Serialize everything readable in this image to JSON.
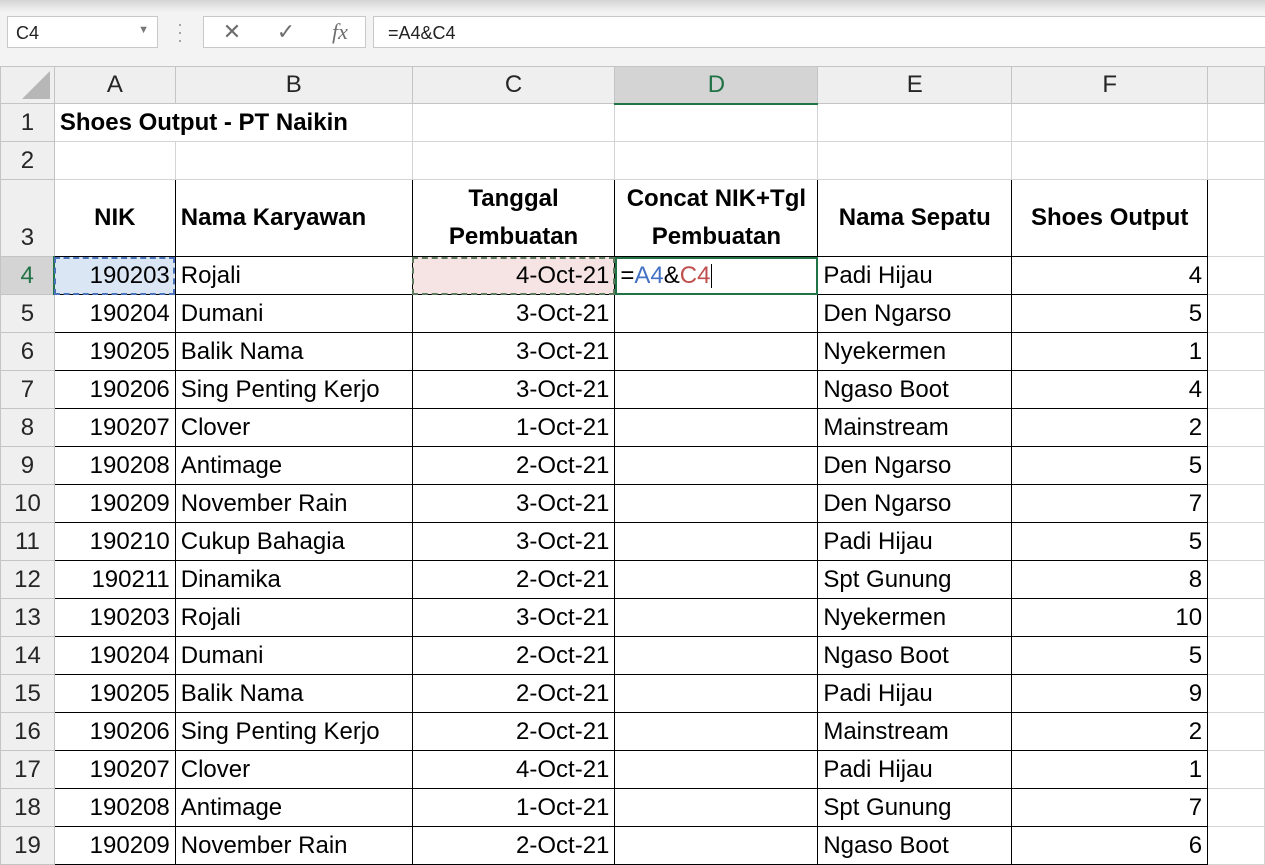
{
  "name_box": {
    "value": "C4"
  },
  "formula_bar": {
    "cancel_glyph": "✕",
    "enter_glyph": "✓",
    "fx_glyph": "fx",
    "formula": "=A4&C4"
  },
  "columns": [
    "A",
    "B",
    "C",
    "D",
    "E",
    "F"
  ],
  "title": "Shoes Output - PT Naikin",
  "row_numbers": [
    "1",
    "2",
    "3",
    "4",
    "5",
    "6",
    "7",
    "8",
    "9",
    "10",
    "11",
    "12",
    "13",
    "14",
    "15",
    "16",
    "17",
    "18",
    "19"
  ],
  "headers": {
    "nik": "NIK",
    "nama": "Nama Karyawan",
    "tanggal_1": "Tanggal",
    "tanggal_2": "Pembuatan",
    "concat_1": "Concat NIK+Tgl",
    "concat_2": "Pembuatan",
    "sepatu": "Nama Sepatu",
    "output": "Shoes Output"
  },
  "edit_cell": {
    "eq": "=",
    "ref_a": "A4",
    "amp": "&",
    "ref_c": "C4"
  },
  "rows": [
    {
      "nik": "190203",
      "nama": "Rojali",
      "tgl": "4-Oct-21",
      "sepatu": "Padi Hijau",
      "out": "4"
    },
    {
      "nik": "190204",
      "nama": "Dumani",
      "tgl": "3-Oct-21",
      "sepatu": "Den Ngarso",
      "out": "5"
    },
    {
      "nik": "190205",
      "nama": "Balik Nama",
      "tgl": "3-Oct-21",
      "sepatu": "Nyekermen",
      "out": "1"
    },
    {
      "nik": "190206",
      "nama": "Sing Penting Kerjo",
      "tgl": "3-Oct-21",
      "sepatu": "Ngaso Boot",
      "out": "4"
    },
    {
      "nik": "190207",
      "nama": "Clover",
      "tgl": "1-Oct-21",
      "sepatu": "Mainstream",
      "out": "2"
    },
    {
      "nik": "190208",
      "nama": "Antimage",
      "tgl": "2-Oct-21",
      "sepatu": "Den Ngarso",
      "out": "5"
    },
    {
      "nik": "190209",
      "nama": "November Rain",
      "tgl": "3-Oct-21",
      "sepatu": "Den Ngarso",
      "out": "7"
    },
    {
      "nik": "190210",
      "nama": "Cukup Bahagia",
      "tgl": "3-Oct-21",
      "sepatu": "Padi Hijau",
      "out": "5"
    },
    {
      "nik": "190211",
      "nama": "Dinamika",
      "tgl": "2-Oct-21",
      "sepatu": "Spt Gunung",
      "out": "8"
    },
    {
      "nik": "190203",
      "nama": "Rojali",
      "tgl": "3-Oct-21",
      "sepatu": "Nyekermen",
      "out": "10"
    },
    {
      "nik": "190204",
      "nama": "Dumani",
      "tgl": "2-Oct-21",
      "sepatu": "Ngaso Boot",
      "out": "5"
    },
    {
      "nik": "190205",
      "nama": "Balik Nama",
      "tgl": "2-Oct-21",
      "sepatu": "Padi Hijau",
      "out": "9"
    },
    {
      "nik": "190206",
      "nama": "Sing Penting Kerjo",
      "tgl": "2-Oct-21",
      "sepatu": "Mainstream",
      "out": "2"
    },
    {
      "nik": "190207",
      "nama": "Clover",
      "tgl": "4-Oct-21",
      "sepatu": "Padi Hijau",
      "out": "1"
    },
    {
      "nik": "190208",
      "nama": "Antimage",
      "tgl": "1-Oct-21",
      "sepatu": "Spt Gunung",
      "out": "7"
    },
    {
      "nik": "190209",
      "nama": "November Rain",
      "tgl": "2-Oct-21",
      "sepatu": "Ngaso Boot",
      "out": "6"
    }
  ]
}
